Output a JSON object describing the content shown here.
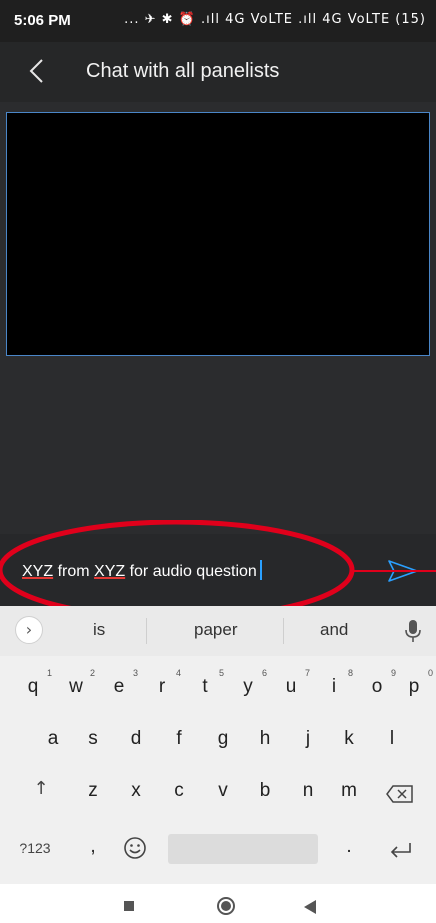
{
  "status": {
    "time": "5:06 PM",
    "icons_text": "... ✈ ✱ ⏰ .ıll 4G VoLTE .ıll 4G VoLTE (15)",
    "battery": "15"
  },
  "header": {
    "title": "Chat with all panelists"
  },
  "compose": {
    "text_parts": [
      "XYZ",
      " from ",
      "XYZ",
      " for audio question"
    ]
  },
  "keyboard": {
    "suggestions": [
      "is",
      "paper",
      "and"
    ],
    "row1": [
      {
        "k": "q",
        "h": "1"
      },
      {
        "k": "w",
        "h": "2"
      },
      {
        "k": "e",
        "h": "3"
      },
      {
        "k": "r",
        "h": "4"
      },
      {
        "k": "t",
        "h": "5"
      },
      {
        "k": "y",
        "h": "6"
      },
      {
        "k": "u",
        "h": "7"
      },
      {
        "k": "i",
        "h": "8"
      },
      {
        "k": "o",
        "h": "9"
      },
      {
        "k": "p",
        "h": "0"
      }
    ],
    "row2": [
      "a",
      "s",
      "d",
      "f",
      "g",
      "h",
      "j",
      "k",
      "l"
    ],
    "row3": [
      "z",
      "x",
      "c",
      "v",
      "b",
      "n",
      "m"
    ],
    "symbols_label": "?123",
    "comma": ",",
    "period": "."
  },
  "colors": {
    "accent": "#2aa0ff",
    "annotation": "#e0001b",
    "appbar": "#262728"
  }
}
